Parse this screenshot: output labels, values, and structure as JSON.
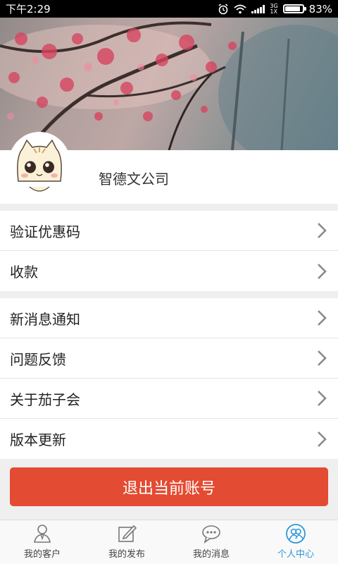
{
  "status_bar": {
    "time": "下午2:29",
    "network": "3G",
    "network_sub": "1X",
    "battery": "83%"
  },
  "profile": {
    "company_name": "智德文公司"
  },
  "menu_group_1": [
    {
      "label": "验证优惠码"
    },
    {
      "label": "收款"
    }
  ],
  "menu_group_2": [
    {
      "label": "新消息通知"
    },
    {
      "label": "问题反馈"
    },
    {
      "label": "关于茄子会"
    },
    {
      "label": "版本更新"
    }
  ],
  "logout_label": "退出当前账号",
  "tabs": [
    {
      "label": "我的客户",
      "icon": "customer-icon"
    },
    {
      "label": "我的发布",
      "icon": "edit-icon"
    },
    {
      "label": "我的消息",
      "icon": "message-icon"
    },
    {
      "label": "个人中心",
      "icon": "profile-icon",
      "active": true
    }
  ],
  "colors": {
    "accent": "#e34b32",
    "tab_active": "#2d98d8"
  }
}
